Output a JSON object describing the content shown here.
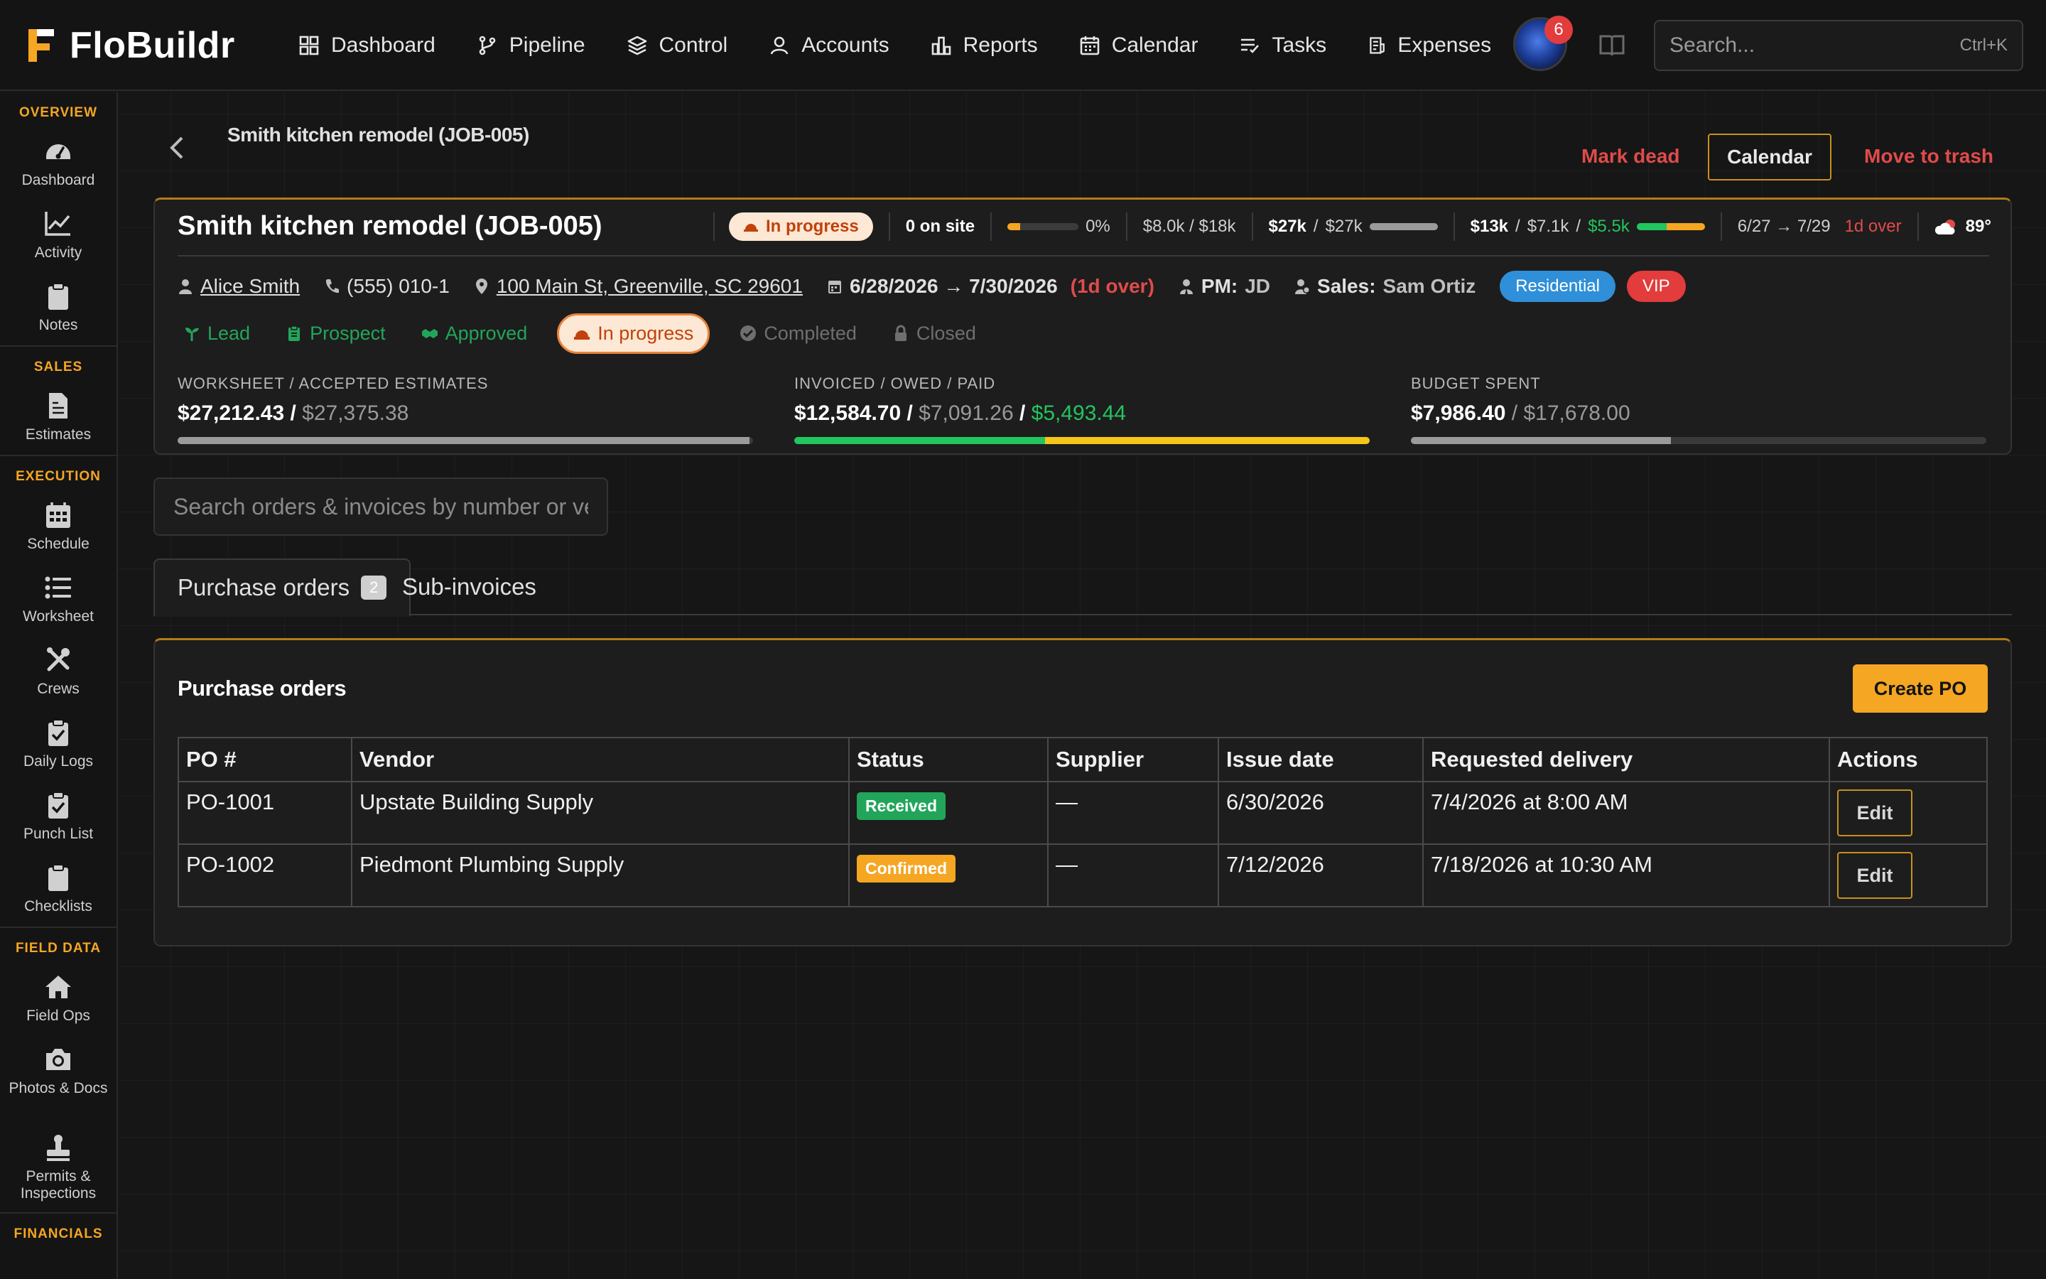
{
  "app": {
    "name": "FloBuildr",
    "nav": [
      {
        "label": "Dashboard",
        "icon": "grid-icon"
      },
      {
        "label": "Pipeline",
        "icon": "branch-icon"
      },
      {
        "label": "Control",
        "icon": "layers-icon"
      },
      {
        "label": "Accounts",
        "icon": "user-icon"
      },
      {
        "label": "Reports",
        "icon": "bar-chart-icon"
      },
      {
        "label": "Calendar",
        "icon": "calendar-icon"
      },
      {
        "label": "Tasks",
        "icon": "tasks-icon"
      },
      {
        "label": "Expenses",
        "icon": "receipt-icon"
      }
    ],
    "notification_count": "6",
    "search": {
      "placeholder": "Search...",
      "shortcut": "Ctrl+K"
    }
  },
  "sidebar": {
    "sections": [
      {
        "heading": "OVERVIEW",
        "items": [
          {
            "label": "Dashboard",
            "icon": "gauge-icon"
          },
          {
            "label": "Activity",
            "icon": "activity-icon"
          },
          {
            "label": "Notes",
            "icon": "clipboard-icon"
          }
        ]
      },
      {
        "heading": "SALES",
        "items": [
          {
            "label": "Estimates",
            "icon": "estimate-icon"
          }
        ]
      },
      {
        "heading": "EXECUTION",
        "items": [
          {
            "label": "Schedule",
            "icon": "calendar-grid-icon"
          },
          {
            "label": "Worksheet",
            "icon": "list-icon"
          },
          {
            "label": "Crews",
            "icon": "tools-icon"
          },
          {
            "label": "Daily Logs",
            "icon": "clipboard-check-icon"
          },
          {
            "label": "Punch List",
            "icon": "clipboard-check-icon"
          },
          {
            "label": "Checklists",
            "icon": "clipboard-icon"
          }
        ]
      },
      {
        "heading": "FIELD DATA",
        "items": [
          {
            "label": "Field Ops",
            "icon": "home-icon"
          },
          {
            "label": "Photos & Docs",
            "icon": "camera-icon"
          },
          {
            "label": "Permits & Inspections",
            "icon": "stamp-icon"
          }
        ]
      },
      {
        "heading": "FINANCIALS",
        "items": []
      }
    ]
  },
  "header": {
    "breadcrumb_title": "Smith kitchen remodel (JOB-005)",
    "mark_dead": "Mark dead",
    "calendar": "Calendar",
    "move_to_trash": "Move to trash"
  },
  "job": {
    "title": "Smith kitchen remodel (JOB-005)",
    "status": "In progress",
    "on_site": "0 on site",
    "percent_complete": "0%",
    "percent_fill": 0.18,
    "budget_short": "$8.0k / $18k",
    "estimate_short": {
      "a": "$27k",
      "b": "$27k"
    },
    "estimate_fill": 1.0,
    "invoice_short": {
      "a": "$13k",
      "b": "$7.1k",
      "c": "$5.5k"
    },
    "dates_short": "6/27 → 7/29",
    "over_short": "1d over",
    "temperature": "89°",
    "client": "Alice Smith",
    "phone": "(555) 010-1",
    "address": "100 Main St, Greenville, SC 29601",
    "date_range": "6/28/2026 → 7/30/2026",
    "over_days": "(1d over)",
    "pm_label": "PM:",
    "pm": "JD",
    "sales_label": "Sales:",
    "sales": "Sam Ortiz",
    "tags": [
      {
        "label": "Residential",
        "color": "#2f8fd8"
      },
      {
        "label": "VIP",
        "color": "#e23c3c"
      }
    ],
    "stages": [
      {
        "label": "Lead",
        "state": "done",
        "icon": "sprout-icon"
      },
      {
        "label": "Prospect",
        "state": "done",
        "icon": "clipboard-icon"
      },
      {
        "label": "Approved",
        "state": "done",
        "icon": "handshake-icon"
      },
      {
        "label": "In progress",
        "state": "active",
        "icon": "hardhat-icon"
      },
      {
        "label": "Completed",
        "state": "todo",
        "icon": "check-circle-icon"
      },
      {
        "label": "Closed",
        "state": "todo",
        "icon": "lock-icon"
      }
    ],
    "financials": {
      "worksheet": {
        "label": "WORKSHEET / ACCEPTED ESTIMATES",
        "a": "$27,212.43",
        "b": "$27,375.38",
        "fill": 0.994
      },
      "invoiced": {
        "label": "INVOICED / OWED / PAID",
        "a": "$12,584.70",
        "b": "$7,091.26",
        "c": "$5,493.44",
        "paid_fill": 0.436,
        "owed_fill": 0.564
      },
      "budget": {
        "label": "BUDGET SPENT",
        "a": "$7,986.40",
        "b": "$17,678.00",
        "fill": 0.452
      }
    }
  },
  "orders": {
    "search_placeholder": "Search orders & invoices by number or vendor",
    "tabs": [
      {
        "label": "Purchase orders",
        "count": "2"
      },
      {
        "label": "Sub-invoices"
      }
    ],
    "card_title": "Purchase orders",
    "create_label": "Create PO",
    "columns": [
      "PO #",
      "Vendor",
      "Status",
      "Supplier",
      "Issue date",
      "Requested delivery",
      "Actions"
    ],
    "rows": [
      {
        "po": "PO-1001",
        "vendor": "Upstate Building Supply",
        "status": "Received",
        "status_color": "#22a55a",
        "supplier": "—",
        "issue": "6/30/2026",
        "delivery": "7/4/2026 at 8:00 AM",
        "action": "Edit"
      },
      {
        "po": "PO-1002",
        "vendor": "Piedmont Plumbing Supply",
        "status": "Confirmed",
        "status_color": "#f5a623",
        "supplier": "—",
        "issue": "7/12/2026",
        "delivery": "7/18/2026 at 10:30 AM",
        "action": "Edit"
      }
    ]
  },
  "colors": {
    "accent": "#f5a623",
    "danger": "#e04b4b",
    "success": "#22c55e",
    "background": "#161616"
  }
}
